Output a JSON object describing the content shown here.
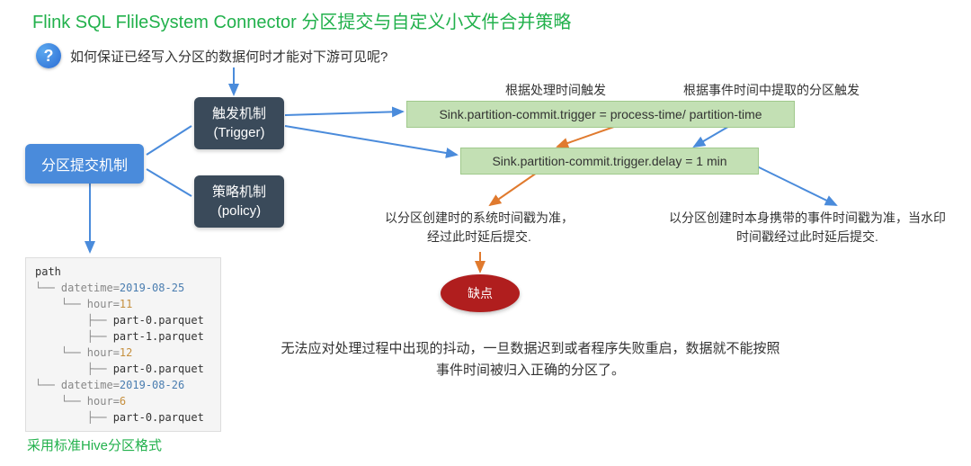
{
  "title": "Flink SQL FlileSystem Connector 分区提交与自定义小文件合并策略",
  "question": "如何保证已经写入分区的数据何时才能对下游可见呢?",
  "box_partition_commit": "分区提交机制",
  "box_trigger_line1": "触发机制",
  "box_trigger_line2": "(Trigger)",
  "box_policy_line1": "策略机制",
  "box_policy_line2": "(policy)",
  "label_process_time": "根据处理时间触发",
  "label_event_time": "根据事件时间中提取的分区触发",
  "green1": "Sink.partition-commit.trigger = process-time/ partition-time",
  "green2": "Sink.partition-commit.trigger.delay = 1 min",
  "note_left": "以分区创建时的系统时间戳为准，经过此时延后提交.",
  "note_right": "以分区创建时本身携带的事件时间戳为准，当水印时间戳经过此时延后提交.",
  "defect": "缺点",
  "defect_desc": "无法应对处理过程中出现的抖动，一旦数据迟到或者程序失败重启，数据就不能按照事件时间被归入正确的分区了。",
  "hive": "采用标准Hive分区格式",
  "path_plain": "path",
  "path_l1_pre": "└── datetime=",
  "path_l1_date": "2019-08-25",
  "path_l2_pre": "    └── hour=",
  "path_l2_num": "11",
  "path_l3_pre": "        ├── ",
  "path_l3_file": "part-0.parquet",
  "path_l4_pre": "        ├── ",
  "path_l4_file": "part-1.parquet",
  "path_l5_pre": "    └── hour=",
  "path_l5_num": "12",
  "path_l6_pre": "        ├── ",
  "path_l6_file": "part-0.parquet",
  "path_l7_pre": "└── datetime=",
  "path_l7_date": "2019-08-26",
  "path_l8_pre": "    └── hour=",
  "path_l8_num": "6",
  "path_l9_pre": "        ├── ",
  "path_l9_file": "part-0.parquet"
}
